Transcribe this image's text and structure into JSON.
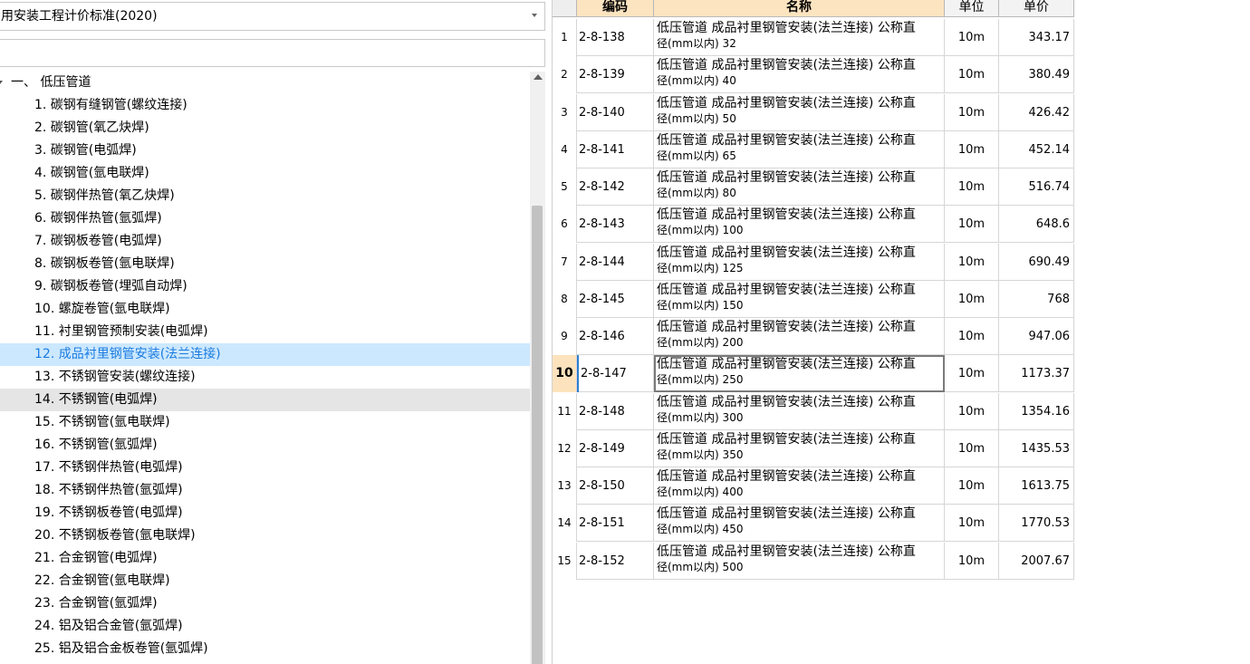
{
  "standard_select": {
    "value": "用安装工程计价标准(2020)"
  },
  "search": {
    "placeholder": ""
  },
  "tree": {
    "root_label": "一、 低压管道",
    "items": [
      "1. 碳钢有缝钢管(螺纹连接)",
      "2. 碳钢管(氧乙炔焊)",
      "3. 碳钢管(电弧焊)",
      "4. 碳钢管(氩电联焊)",
      "5. 碳钢伴热管(氧乙炔焊)",
      "6. 碳钢伴热管(氩弧焊)",
      "7. 碳钢板卷管(电弧焊)",
      "8. 碳钢板卷管(氩电联焊)",
      "9. 碳钢板卷管(埋弧自动焊)",
      "10. 螺旋卷管(氩电联焊)",
      "11. 衬里钢管预制安装(电弧焊)",
      "12. 成品衬里钢管安装(法兰连接)",
      "13. 不锈钢管安装(螺纹连接)",
      "14. 不锈钢管(电弧焊)",
      "15. 不锈钢管(氩电联焊)",
      "16. 不锈钢管(氩弧焊)",
      "17. 不锈钢伴热管(电弧焊)",
      "18. 不锈钢伴热管(氩弧焊)",
      "19. 不锈钢板卷管(电弧焊)",
      "20. 不锈钢板卷管(氩电联焊)",
      "21. 合金钢管(电弧焊)",
      "22. 合金钢管(氩电联焊)",
      "23. 合金钢管(氩弧焊)",
      "24. 铝及铝合金管(氩弧焊)",
      "25. 铝及铝合金板卷管(氩弧焊)"
    ],
    "selected_index": 11,
    "hover_index": 13
  },
  "grid": {
    "headers": {
      "code": "编码",
      "name": "名称",
      "unit": "单位",
      "price": "单价"
    },
    "current_row": 10,
    "rows": [
      {
        "no": "1",
        "code": "2-8-138",
        "name1": "低压管道 成品衬里钢管安装(法兰连接) 公称直",
        "name2": "径(mm以内) 32",
        "unit": "10m",
        "price": "343.17"
      },
      {
        "no": "2",
        "code": "2-8-139",
        "name1": "低压管道 成品衬里钢管安装(法兰连接) 公称直",
        "name2": "径(mm以内) 40",
        "unit": "10m",
        "price": "380.49"
      },
      {
        "no": "3",
        "code": "2-8-140",
        "name1": "低压管道 成品衬里钢管安装(法兰连接) 公称直",
        "name2": "径(mm以内) 50",
        "unit": "10m",
        "price": "426.42"
      },
      {
        "no": "4",
        "code": "2-8-141",
        "name1": "低压管道 成品衬里钢管安装(法兰连接) 公称直",
        "name2": "径(mm以内) 65",
        "unit": "10m",
        "price": "452.14"
      },
      {
        "no": "5",
        "code": "2-8-142",
        "name1": "低压管道 成品衬里钢管安装(法兰连接) 公称直",
        "name2": "径(mm以内) 80",
        "unit": "10m",
        "price": "516.74"
      },
      {
        "no": "6",
        "code": "2-8-143",
        "name1": "低压管道 成品衬里钢管安装(法兰连接) 公称直",
        "name2": "径(mm以内) 100",
        "unit": "10m",
        "price": "648.6"
      },
      {
        "no": "7",
        "code": "2-8-144",
        "name1": "低压管道 成品衬里钢管安装(法兰连接) 公称直",
        "name2": "径(mm以内) 125",
        "unit": "10m",
        "price": "690.49"
      },
      {
        "no": "8",
        "code": "2-8-145",
        "name1": "低压管道 成品衬里钢管安装(法兰连接) 公称直",
        "name2": "径(mm以内) 150",
        "unit": "10m",
        "price": "768"
      },
      {
        "no": "9",
        "code": "2-8-146",
        "name1": "低压管道 成品衬里钢管安装(法兰连接) 公称直",
        "name2": "径(mm以内) 200",
        "unit": "10m",
        "price": "947.06"
      },
      {
        "no": "10",
        "code": "2-8-147",
        "name1": "低压管道 成品衬里钢管安装(法兰连接) 公称直",
        "name2": "径(mm以内) 250",
        "unit": "10m",
        "price": "1173.37"
      },
      {
        "no": "11",
        "code": "2-8-148",
        "name1": "低压管道 成品衬里钢管安装(法兰连接) 公称直",
        "name2": "径(mm以内) 300",
        "unit": "10m",
        "price": "1354.16"
      },
      {
        "no": "12",
        "code": "2-8-149",
        "name1": "低压管道 成品衬里钢管安装(法兰连接) 公称直",
        "name2": "径(mm以内) 350",
        "unit": "10m",
        "price": "1435.53"
      },
      {
        "no": "13",
        "code": "2-8-150",
        "name1": "低压管道 成品衬里钢管安装(法兰连接) 公称直",
        "name2": "径(mm以内) 400",
        "unit": "10m",
        "price": "1613.75"
      },
      {
        "no": "14",
        "code": "2-8-151",
        "name1": "低压管道 成品衬里钢管安装(法兰连接) 公称直",
        "name2": "径(mm以内) 450",
        "unit": "10m",
        "price": "1770.53"
      },
      {
        "no": "15",
        "code": "2-8-152",
        "name1": "低压管道 成品衬里钢管安装(法兰连接) 公称直",
        "name2": "径(mm以内) 500",
        "unit": "10m",
        "price": "2007.67"
      }
    ]
  },
  "colors": {
    "selected_bg": "#cce8ff",
    "selected_text": "#1a7be0",
    "header_accent": "#fce4c0",
    "active_row_num": "#fde3bd"
  }
}
